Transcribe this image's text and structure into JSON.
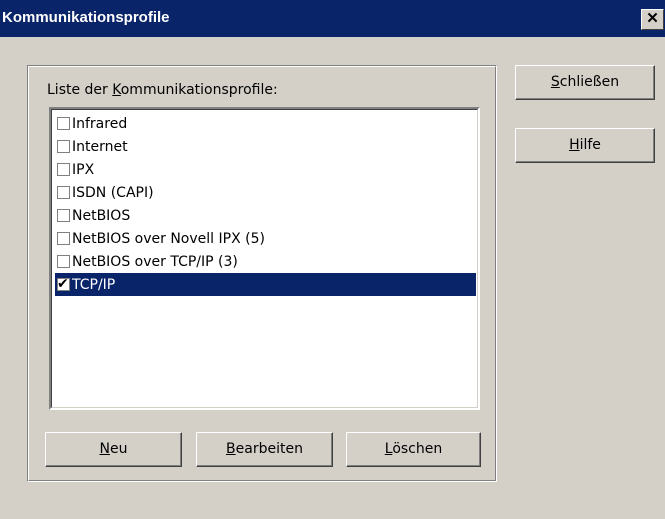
{
  "window": {
    "title": "Kommunikationsprofile",
    "close_glyph": "✕"
  },
  "list": {
    "label_prefix": "Liste der ",
    "label_accel": "K",
    "label_rest": "ommunikationsprofile:",
    "items": [
      {
        "label": "Infrared",
        "checked": false,
        "selected": false
      },
      {
        "label": "Internet",
        "checked": false,
        "selected": false
      },
      {
        "label": "IPX",
        "checked": false,
        "selected": false
      },
      {
        "label": "ISDN (CAPI)",
        "checked": false,
        "selected": false
      },
      {
        "label": "NetBIOS",
        "checked": false,
        "selected": false
      },
      {
        "label": "NetBIOS over Novell IPX (5)",
        "checked": false,
        "selected": false
      },
      {
        "label": "NetBIOS over TCP/IP (3)",
        "checked": false,
        "selected": false
      },
      {
        "label": "TCP/IP",
        "checked": true,
        "selected": true
      }
    ],
    "check_glyph": "✔"
  },
  "buttons": {
    "close": {
      "accel": "S",
      "rest": "chließen"
    },
    "help": {
      "accel": "H",
      "rest": "ilfe"
    },
    "new": {
      "accel": "N",
      "rest": "eu"
    },
    "edit": {
      "accel": "B",
      "rest": "earbeiten"
    },
    "delete": {
      "accel": "L",
      "rest": "öschen"
    }
  },
  "colors": {
    "face": "#d4d0c8",
    "title_bar": "#0a246a",
    "selection": "#0a246a"
  }
}
